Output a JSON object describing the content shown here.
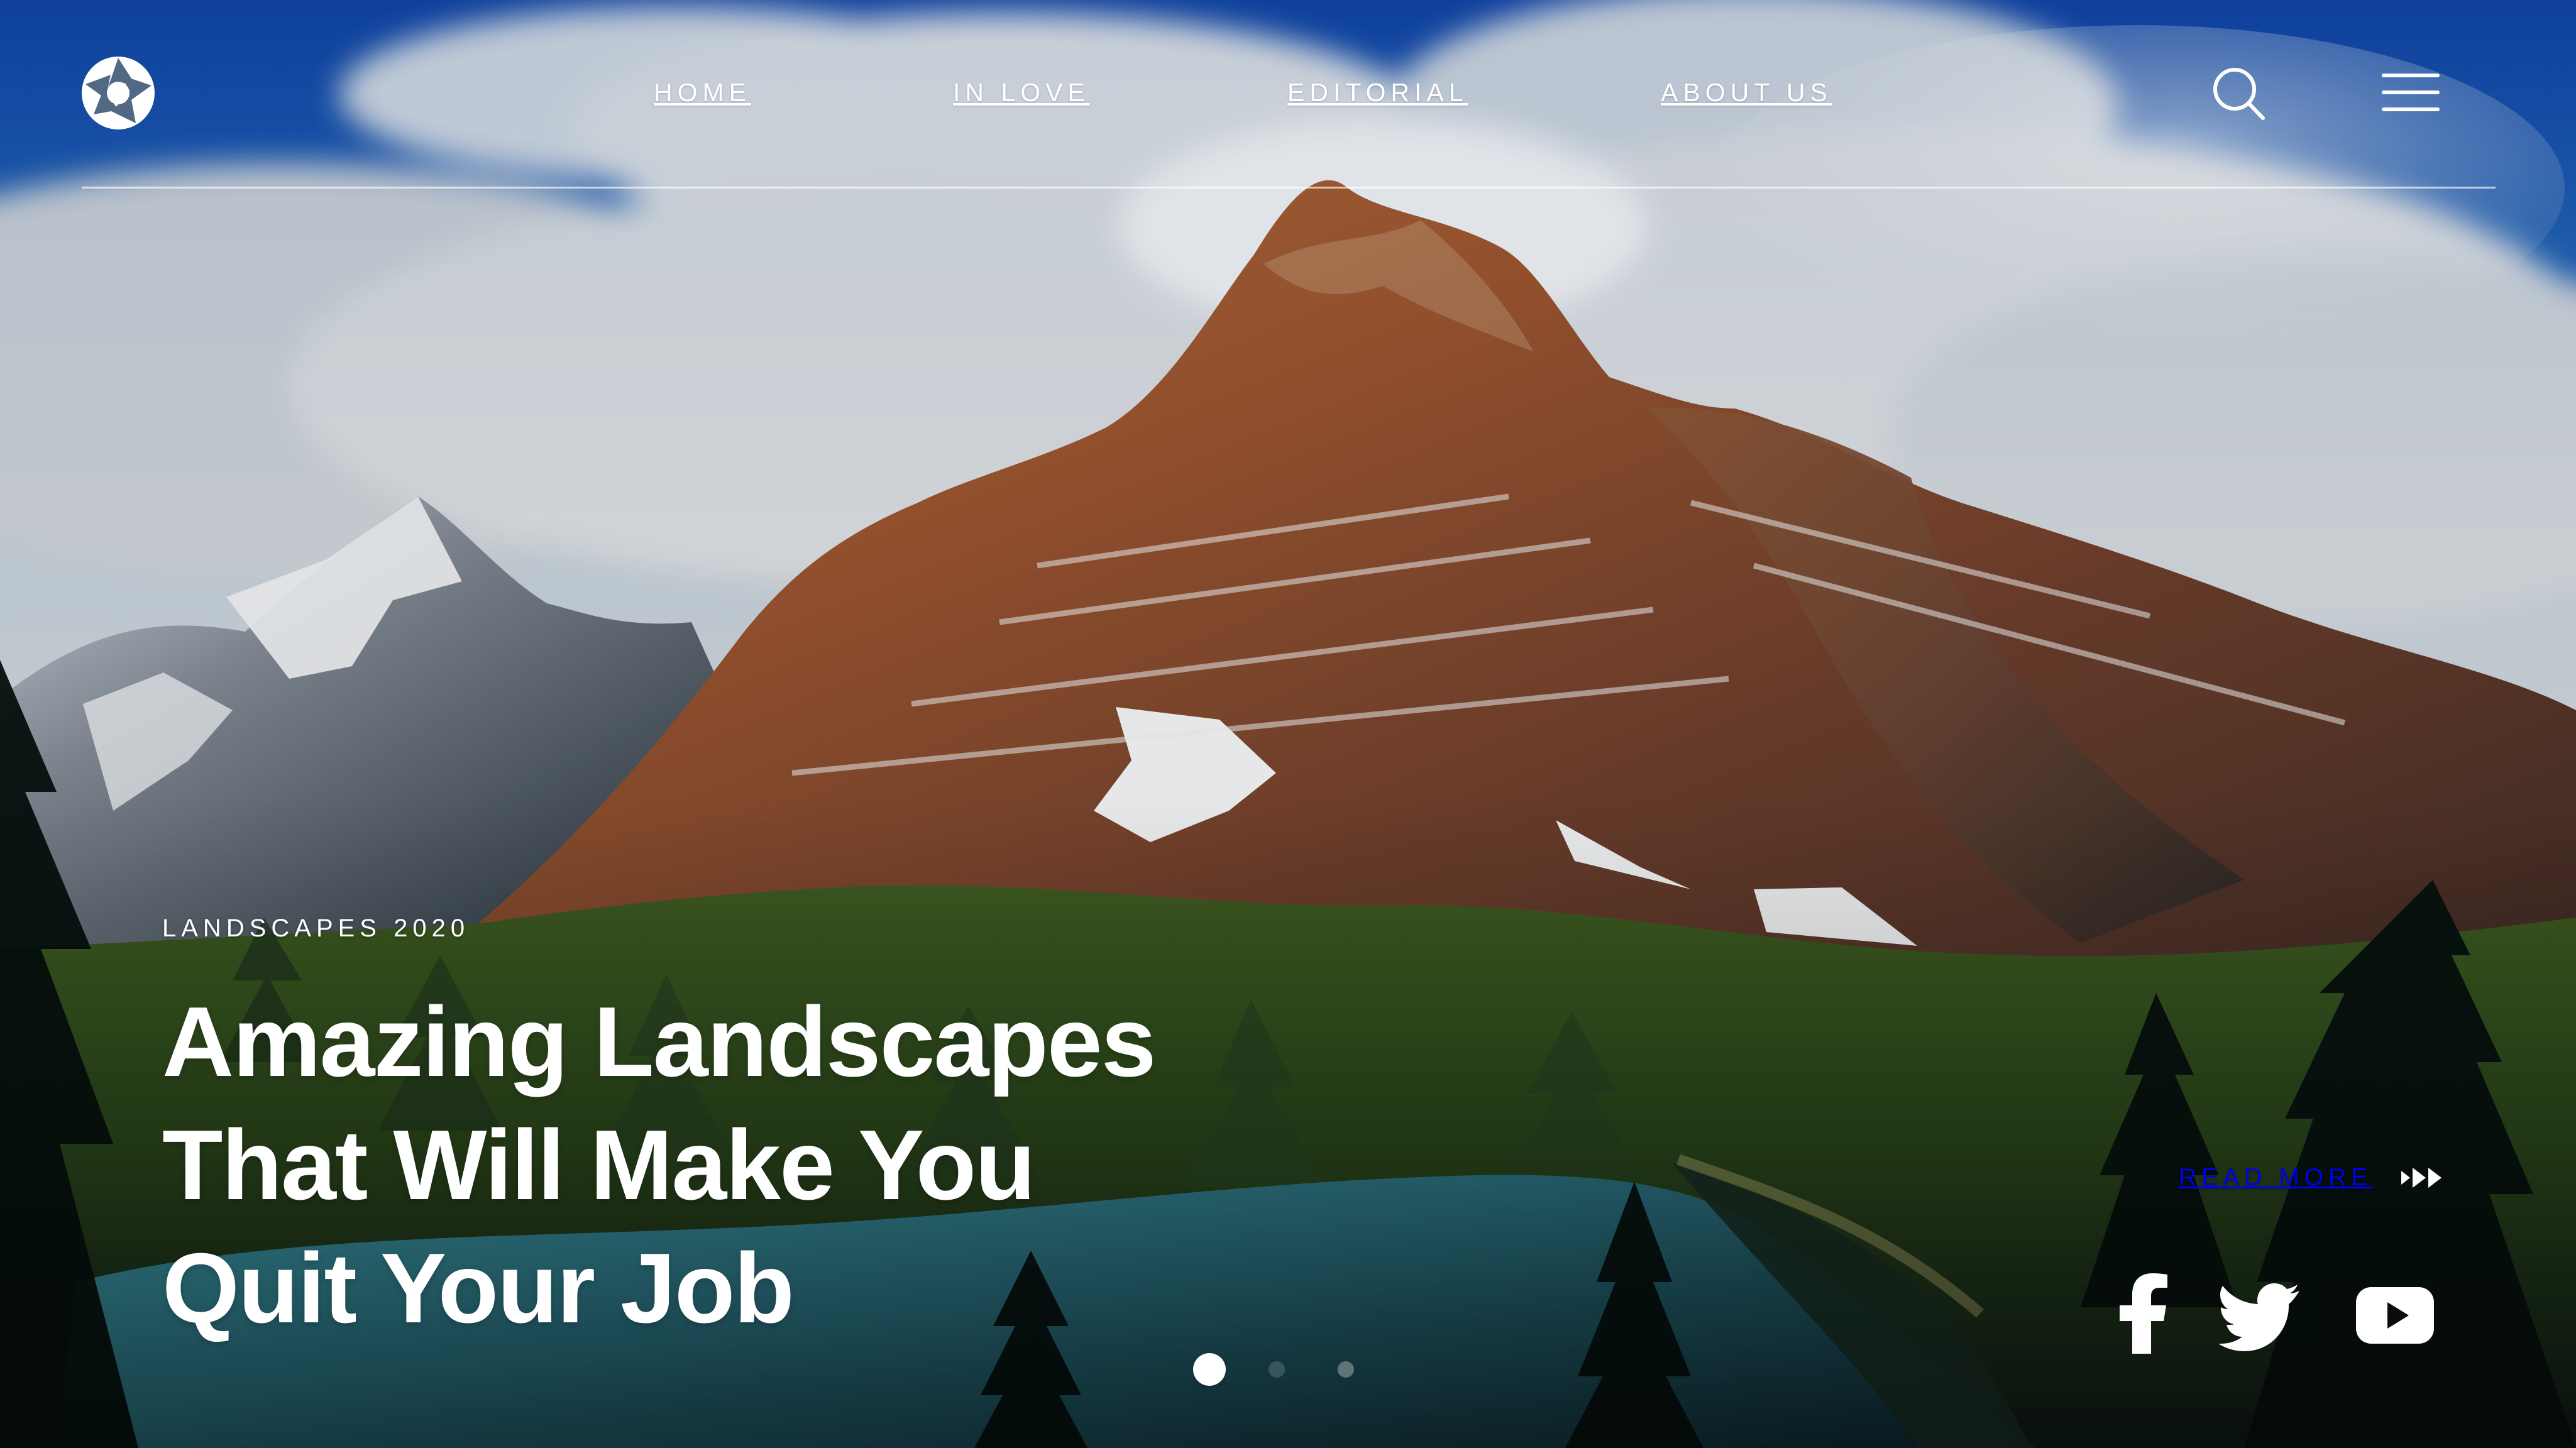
{
  "header": {
    "logo_icon": "camera-shutter-icon",
    "navigation": [
      {
        "label": "HOME",
        "active": false
      },
      {
        "label": "IN LOVE",
        "active": false
      },
      {
        "label": "EDITORIAL",
        "active": false
      },
      {
        "label": "ABOUT US",
        "active": false
      }
    ],
    "search_icon": "search-icon",
    "menu_icon": "hamburger-menu-icon"
  },
  "hero": {
    "category": "LANDSCAPES 2020",
    "headline_lines": [
      "Amazing Landscapes",
      "That Will Make You",
      "Quit Your Job"
    ],
    "read_more": {
      "label": "READ MORE",
      "icon": "fast-forward-icon"
    }
  },
  "social": [
    {
      "name": "Facebook",
      "icon": "facebook-icon"
    },
    {
      "name": "Twitter",
      "icon": "twitter-icon"
    },
    {
      "name": "YouTube",
      "icon": "youtube-icon"
    }
  ],
  "slider": {
    "slide_count": 3,
    "active_slide": 1
  },
  "colors": {
    "text": "#FFFFFF",
    "sky": "#1C56A8",
    "mountain": "#8A4E2B",
    "forest": "#2F4F24",
    "lake": "#3D8E9B"
  }
}
